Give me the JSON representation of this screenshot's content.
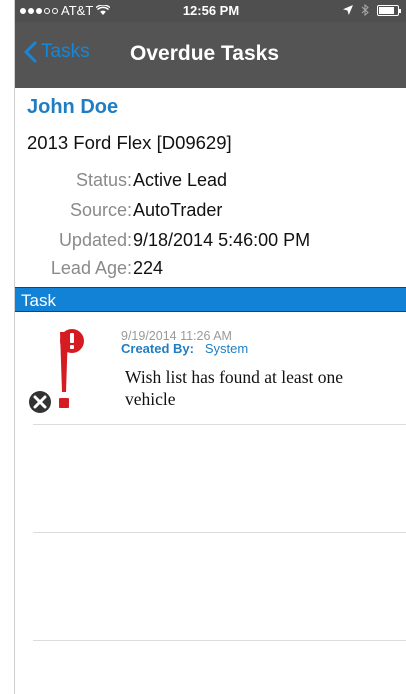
{
  "status_bar": {
    "signal_dots_filled": 3,
    "signal_dots_total": 5,
    "carrier": "AT&T",
    "time": "12:56 PM"
  },
  "nav": {
    "back_label": "Tasks",
    "title": "Overdue Tasks"
  },
  "lead": {
    "name": "John Doe",
    "vehicle": "2013 Ford Flex [D09629]",
    "fields": [
      {
        "label": "Status:",
        "value": "Active Lead"
      },
      {
        "label": "Source:",
        "value": "AutoTrader"
      },
      {
        "label": "Updated:",
        "value": "9/18/2014 5:46:00 PM"
      },
      {
        "label": "Lead Age:",
        "value": "224"
      }
    ]
  },
  "section_header": "Task",
  "tasks": [
    {
      "date": "9/19/2014 11:26 AM",
      "created_by_label": "Created By:",
      "created_by": "System",
      "description": "Wish list has found at least one vehicle",
      "icon": "overdue-alert-icon"
    }
  ],
  "colors": {
    "accent": "#1182d6",
    "link_blue": "#1f7ec3",
    "nav_bg": "#545454",
    "alert_red": "#d61c23"
  }
}
